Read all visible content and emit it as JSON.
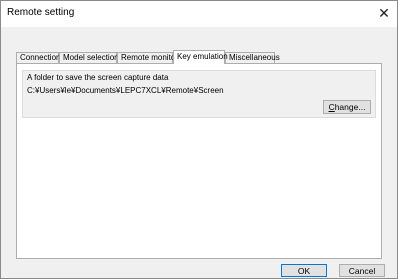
{
  "window": {
    "title": "Remote setting",
    "close_glyph": "✕"
  },
  "tabs": [
    {
      "label": "Connection"
    },
    {
      "label": "Model selection"
    },
    {
      "label": "Remote monitor"
    },
    {
      "label": "Key emulation",
      "active": true
    },
    {
      "label": "Miscellaneous"
    }
  ],
  "panel": {
    "folder_label": "A folder to save the screen capture data",
    "folder_path": "C:¥Users¥le¥Documents¥LEPC7XCL¥Remote¥Screen",
    "change_button": {
      "access_key": "C",
      "rest": "hange..."
    }
  },
  "footer": {
    "ok_label": "OK",
    "cancel_label": "Cancel"
  }
}
